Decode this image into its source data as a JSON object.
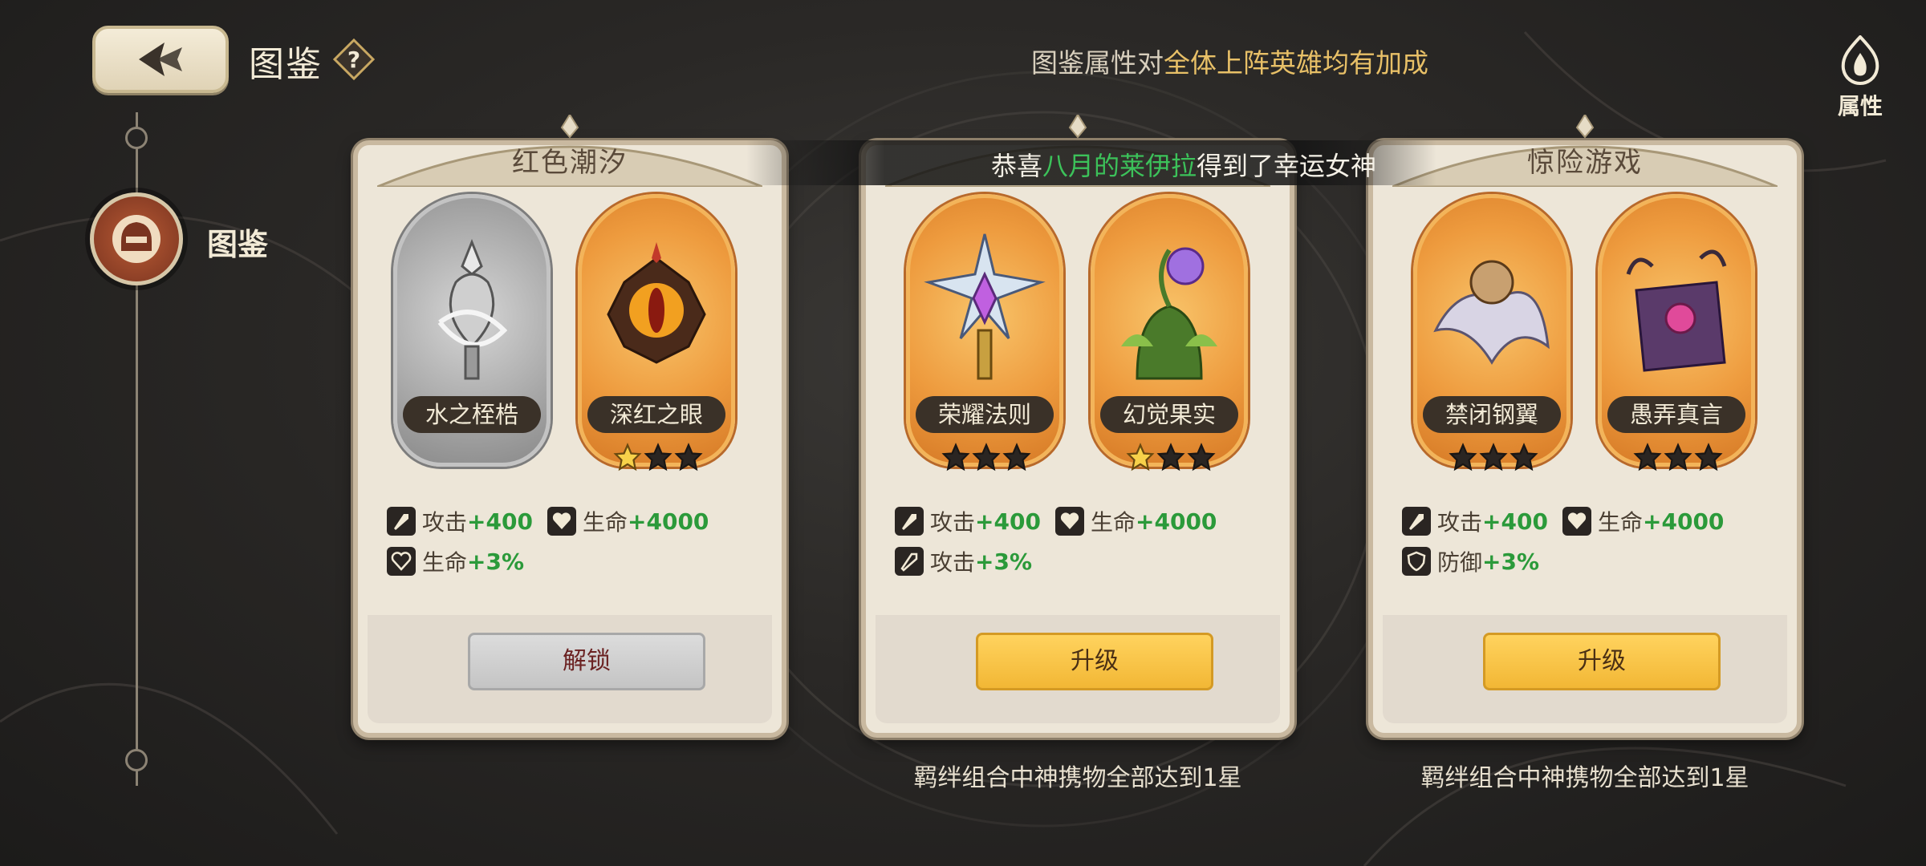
{
  "header": {
    "title": "图鉴",
    "notice_prefix": "图鉴属性对",
    "notice_highlight": "全体上阵英雄均有加成",
    "attr_label": "属性"
  },
  "sidebar": {
    "node_label": "图鉴"
  },
  "broadcast": {
    "prefix": "恭喜",
    "name": "八月的莱伊拉",
    "suffix": "得到了幸运女神"
  },
  "colors": {
    "accent_gold": "#e8c067",
    "stat_green": "#2b9a3a",
    "button_yellow": "#f2b735"
  },
  "cards": [
    {
      "title": "红色潮汐",
      "items": [
        {
          "name": "水之桎梏",
          "rarity": "grey",
          "stars": 0
        },
        {
          "name": "深红之眼",
          "rarity": "gold",
          "stars": 1
        }
      ],
      "stats": [
        {
          "icon": "attack-icon",
          "label": "攻击",
          "value": "+400"
        },
        {
          "icon": "life-icon",
          "label": "生命",
          "value": "+4000"
        },
        {
          "icon": "life-percent-icon",
          "label": "生命",
          "value": "+3%"
        }
      ],
      "button": "解锁",
      "condition": ""
    },
    {
      "title": "",
      "items": [
        {
          "name": "荣耀法则",
          "rarity": "gold",
          "stars": 0
        },
        {
          "name": "幻觉果实",
          "rarity": "gold",
          "stars": 1
        }
      ],
      "stats": [
        {
          "icon": "attack-icon",
          "label": "攻击",
          "value": "+400"
        },
        {
          "icon": "life-icon",
          "label": "生命",
          "value": "+4000"
        },
        {
          "icon": "attack-percent-icon",
          "label": "攻击",
          "value": "+3%"
        }
      ],
      "button": "升级",
      "condition": "羁绊组合中神携物全部达到1星"
    },
    {
      "title": "惊险游戏",
      "items": [
        {
          "name": "禁闭钢翼",
          "rarity": "gold",
          "stars": 0
        },
        {
          "name": "愚弄真言",
          "rarity": "gold",
          "stars": 0
        }
      ],
      "stats": [
        {
          "icon": "attack-icon",
          "label": "攻击",
          "value": "+400"
        },
        {
          "icon": "life-icon",
          "label": "生命",
          "value": "+4000"
        },
        {
          "icon": "defense-icon",
          "label": "防御",
          "value": "+3%"
        }
      ],
      "button": "升级",
      "condition": "羁绊组合中神携物全部达到1星"
    }
  ]
}
